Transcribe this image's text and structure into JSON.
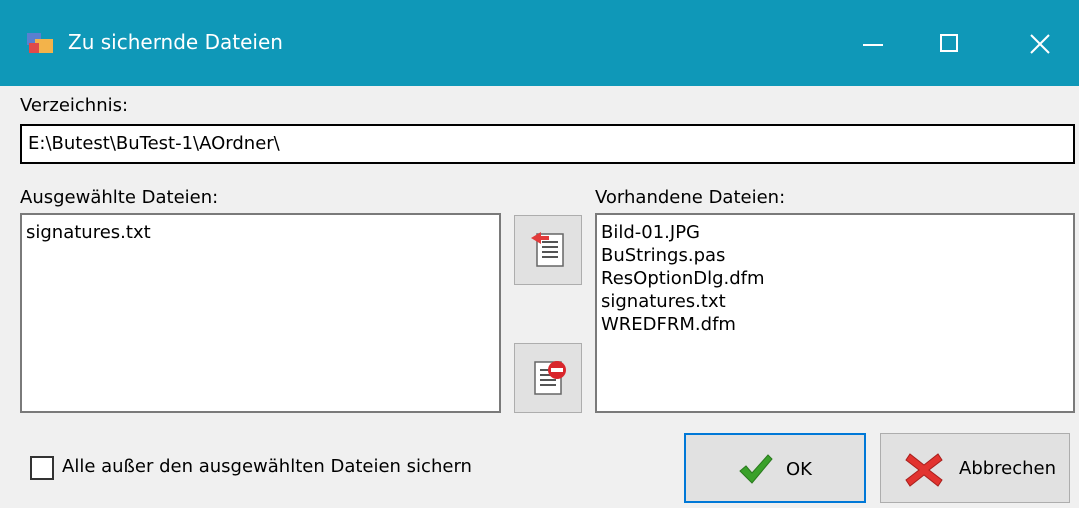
{
  "window": {
    "title": "Zu sichernde Dateien",
    "title_bar_color": "#0f98b8",
    "controls": {
      "minimize_icon": "minimize-icon",
      "maximize_icon": "maximize-icon",
      "close_icon": "close-icon"
    }
  },
  "directory": {
    "label": "Verzeichnis:",
    "value": "E:\\Butest\\BuTest-1\\AOrdner\\"
  },
  "selected_files": {
    "label": "Ausgewählte Dateien:",
    "items": [
      "signatures.txt"
    ]
  },
  "available_files": {
    "label": "Vorhandene Dateien:",
    "items": [
      "Bild-01.JPG",
      "BuStrings.pas",
      "ResOptionDlg.dfm",
      "signatures.txt",
      "WREDFRM.dfm"
    ]
  },
  "transfer_buttons": {
    "add_icon": "add-file-icon",
    "remove_icon": "remove-file-icon"
  },
  "options": {
    "all_except_selected_label": "Alle außer den ausgewählten Dateien sichern",
    "all_except_selected_checked": false
  },
  "buttons": {
    "ok_label": "OK",
    "ok_icon": "checkmark-icon",
    "cancel_label": "Abbrechen",
    "cancel_icon": "red-x-icon",
    "accent_color": "#0078d7"
  }
}
